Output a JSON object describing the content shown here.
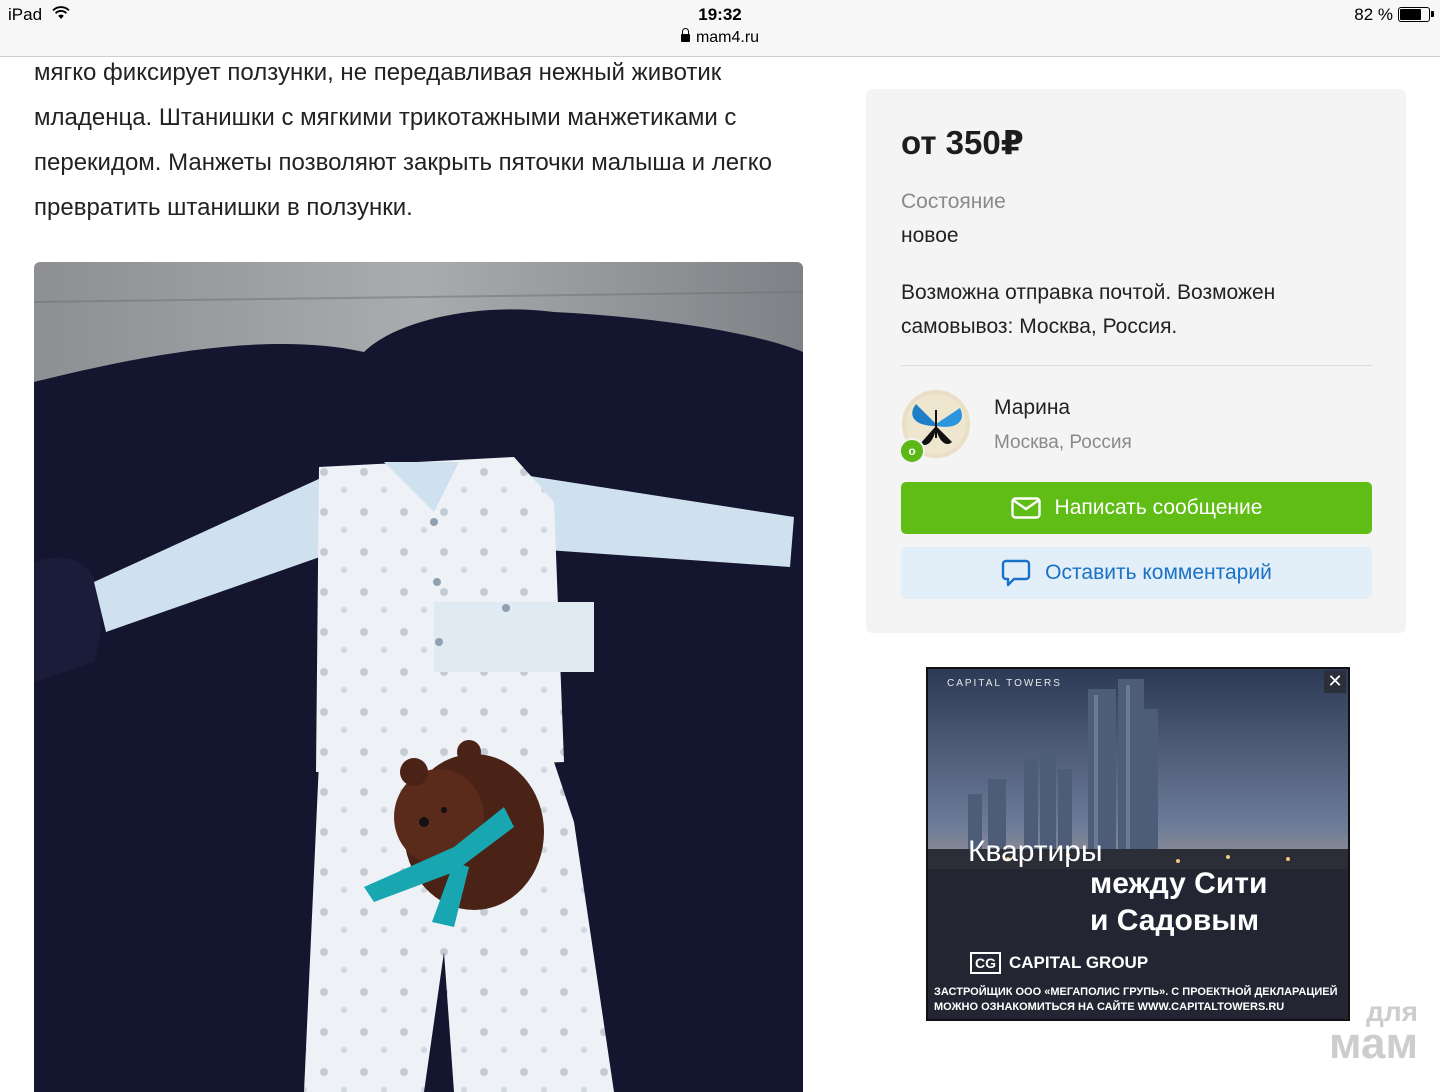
{
  "status_bar": {
    "device": "iPad",
    "time": "19:32",
    "url": "mam4.ru",
    "battery": "82 %",
    "battery_level": 0.82
  },
  "article": {
    "paragraph": "мягко фиксирует ползунки, не передавливая нежный животик младенца. Штанишки с мягкими трикотажными манжетиками с перекидом. Манжеты позволяют закрыть пяточки малыша и легко превратить штанишки в ползунки."
  },
  "listing": {
    "price": "от 350₽",
    "condition_label": "Состояние",
    "condition_value": "новое",
    "delivery": "Возможна отправка почтой. Возможен самовывоз: Москва, Россия."
  },
  "seller": {
    "name": "Марина",
    "city": "Москва, Россия",
    "online_badge": "o"
  },
  "actions": {
    "message_label": "Написать сообщение",
    "comment_label": "Оставить комментарий"
  },
  "ad": {
    "brand": "CAPITAL TOWERS",
    "close": "✕",
    "headline_1": "Квартиры",
    "headline_2": "между Сити",
    "headline_3": "и Садовым",
    "logo_mark": "CG",
    "logo_text": "CAPITAL GROUP",
    "disclaimer": "ЗАСТРОЙЩИК ООО «МЕГАПОЛИС ГРУПЬ». С ПРОЕКТНОЙ ДЕКЛАРАЦИЕЙ МОЖНО ОЗНАКОМИТЬСЯ НА САЙТЕ WWW.CAPITALTOWERS.RU"
  },
  "watermark": {
    "line1": "для",
    "line2": "мам"
  },
  "colors": {
    "accent_green": "#5fbd16",
    "comment_blue": "#1a72c6",
    "comment_bg": "#e2eef8",
    "card_bg": "#f4f4f4"
  }
}
